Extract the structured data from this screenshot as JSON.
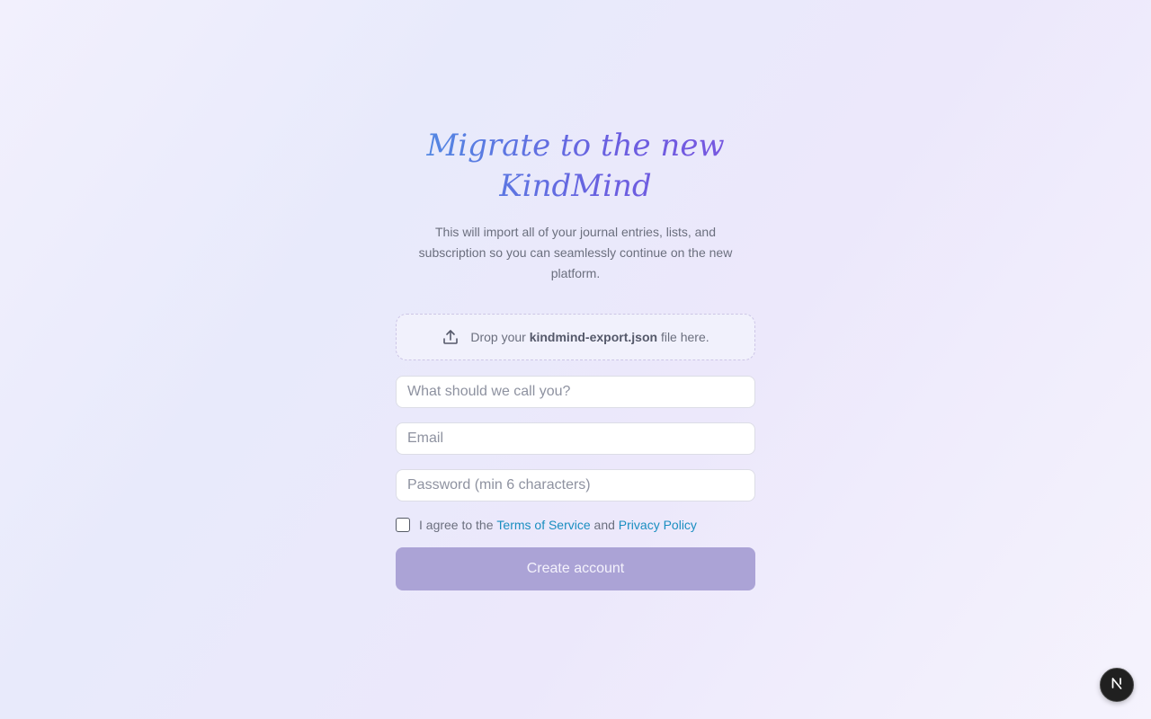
{
  "header": {
    "title_line1": "Migrate to the new",
    "title_line2": "KindMind",
    "subtitle": "This will import all of your journal entries, lists, and subscription so you can seamlessly continue on the new platform."
  },
  "dropzone": {
    "prefix": "Drop your",
    "filename": "kindmind-export.json",
    "suffix": "file here.",
    "icon": "upload-icon"
  },
  "form": {
    "name_placeholder": "What should we call you?",
    "name_value": "",
    "email_placeholder": "Email",
    "email_value": "",
    "password_placeholder": "Password (min 6 characters)",
    "password_value": "",
    "agree_checked": false,
    "agree_prefix": "I agree to the",
    "terms_label": "Terms of Service",
    "agree_and": "and",
    "privacy_label": "Privacy Policy",
    "submit_label": "Create account"
  },
  "dev_badge": {
    "icon": "next-logo-icon"
  },
  "colors": {
    "title_gradient_start": "#4f8ee3",
    "title_gradient_end": "#7a55e0",
    "link": "#1a8ec0",
    "button_bg": "#aba3d6",
    "button_text": "#f4f2fc"
  }
}
